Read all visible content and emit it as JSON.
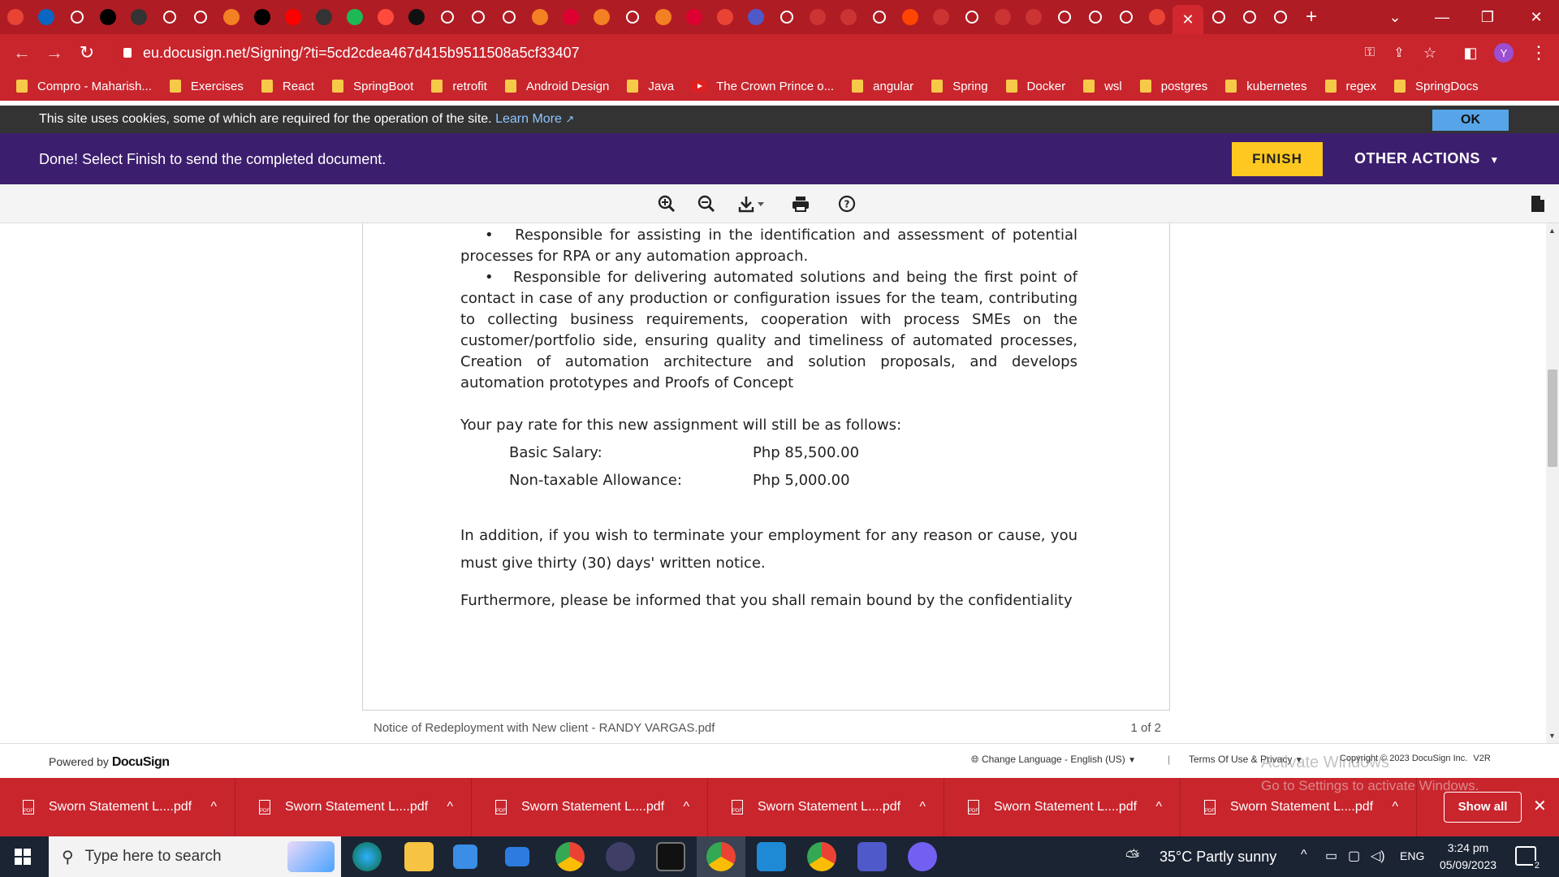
{
  "browser": {
    "url": "eu.docusign.net/Signing/?ti=5cd2cdea467d415b9511508a5cf33407",
    "profile_initial": "Y",
    "tab_icons": [
      "gmail-icon",
      "linkedin-icon",
      "google-icon",
      "medium-icon",
      "github-icon",
      "google-icon",
      "tool-icon",
      "stackoverflow-icon",
      "medium-icon",
      "youtube-icon",
      "github-icon",
      "s-icon",
      "tomato-icon",
      "scroll-icon",
      "google-icon",
      "ms-icon",
      "google-icon",
      "stackoverflow-icon",
      "angular-icon",
      "stackoverflow-icon",
      "google-icon",
      "stackoverflow-icon",
      "angular-icon",
      "gmail-icon",
      "teams-icon",
      "google-icon",
      "pd-icon",
      "pd-icon",
      "google-icon",
      "reddit-icon",
      "pd-icon",
      "globe-icon",
      "pd-icon",
      "pd-icon",
      "globe-icon",
      "openai-icon",
      "globe-icon",
      "gmail-icon"
    ],
    "bookmarks": [
      {
        "label": "Compro - Maharish...",
        "type": "folder"
      },
      {
        "label": "Exercises",
        "type": "folder"
      },
      {
        "label": "React",
        "type": "folder"
      },
      {
        "label": "SpringBoot",
        "type": "folder"
      },
      {
        "label": "retrofit",
        "type": "folder"
      },
      {
        "label": "Android Design",
        "type": "folder"
      },
      {
        "label": "Java",
        "type": "folder"
      },
      {
        "label": "The Crown Prince o...",
        "type": "youtube"
      },
      {
        "label": "angular",
        "type": "folder"
      },
      {
        "label": "Spring",
        "type": "folder"
      },
      {
        "label": "Docker",
        "type": "folder"
      },
      {
        "label": "wsl",
        "type": "folder"
      },
      {
        "label": "postgres",
        "type": "folder"
      },
      {
        "label": "kubernetes",
        "type": "folder"
      },
      {
        "label": "regex",
        "type": "folder"
      },
      {
        "label": "SpringDocs",
        "type": "folder"
      }
    ]
  },
  "cookie": {
    "text": "This site uses cookies, some of which are required for the operation of the site.",
    "link": "Learn More",
    "ok": "OK"
  },
  "done_bar": {
    "message": "Done! Select Finish to send the completed document.",
    "finish": "FINISH",
    "other_actions": "OTHER ACTIONS"
  },
  "document": {
    "bullet1": "Responsible for assisting in the identification and assessment of potential processes for RPA or any automation approach.",
    "bullet2": "Responsible for delivering automated solutions and being the first point of contact in case of any production or configuration issues for the team, contributing to collecting business requirements, cooperation with process SMEs on the customer/portfolio side, ensuring quality and timeliness of automated processes, Creation of automation architecture and solution proposals, and develops automation prototypes and Proofs of Concept",
    "pay_intro": "Your pay rate for this new assignment will still be as follows:",
    "salary_label": "Basic Salary:",
    "salary_value": "Php 85,500.00",
    "allowance_label": "Non-taxable Allowance:",
    "allowance_value": "Php 5,000.00",
    "termination": "In addition, if you wish to terminate your employment for any reason or cause, you must give thirty (30) days' written notice.",
    "furthermore": "Furthermore, please be informed that you shall remain bound by the confidentiality",
    "filename": "Notice of Redeployment with New client - RANDY VARGAS.pdf",
    "page_count": "1 of 2"
  },
  "footer": {
    "powered_by": "Powered by",
    "brand": "DocuSign",
    "language": "Change Language - English (US)",
    "terms": "Terms Of Use & Privacy",
    "copyright": "Copyright © 2023 DocuSign Inc.",
    "version": "V2R",
    "watermark1": "Activate Windows",
    "watermark2": "Go to Settings to activate Windows."
  },
  "downloads": {
    "items": [
      "Sworn Statement L....pdf",
      "Sworn Statement L....pdf",
      "Sworn Statement L....pdf",
      "Sworn Statement L....pdf",
      "Sworn Statement L....pdf",
      "Sworn Statement L....pdf"
    ],
    "show_all": "Show all"
  },
  "taskbar": {
    "search_placeholder": "Type here to search",
    "weather": "35°C  Partly sunny",
    "language": "ENG",
    "time": "3:24 pm",
    "date": "05/09/2023",
    "notifications": "2"
  },
  "colors": {
    "chrome_red": "#c9252d",
    "docusign_purple": "#3c1e6e",
    "finish_yellow": "#ffc820"
  }
}
